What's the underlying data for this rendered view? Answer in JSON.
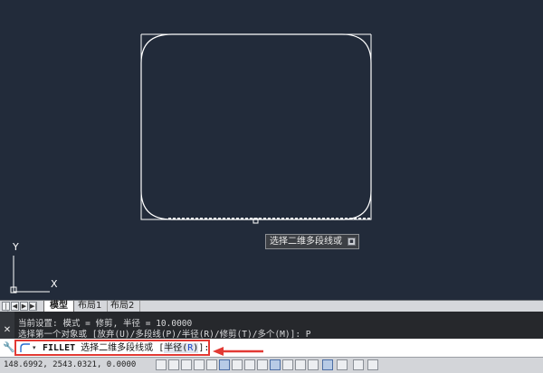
{
  "tooltip": {
    "text": "选择二维多段线或",
    "icon": "▪"
  },
  "ucs": {
    "y_label": "Y",
    "x_label": "X"
  },
  "tabs": [
    {
      "label": "模型",
      "active": true
    },
    {
      "label": "布局1",
      "active": false
    },
    {
      "label": "布局2",
      "active": false
    }
  ],
  "nav_buttons": [
    "|◀",
    "◀",
    "▶",
    "▶|"
  ],
  "history": {
    "line1": "当前设置: 模式 = 修剪, 半径 = 10.0000",
    "line2": "选择第一个对象或 [放弃(U)/多段线(P)/半径(R)/修剪(T)/多个(M)]: P",
    "close": "✕"
  },
  "command": {
    "name": "FILLET",
    "prompt": "选择二维多段线或",
    "open_bracket": "[",
    "option_text": "半径(",
    "option_key": "R",
    "option_close": ")",
    "close_bracket": "]:",
    "dropdown": "▾"
  },
  "status": {
    "coords": "148.6992, 2543.0321, 0.0000"
  },
  "colors": {
    "highlight": "#e23a34",
    "drawing_bg": "#222b3a",
    "geometry": "#ffffff"
  }
}
